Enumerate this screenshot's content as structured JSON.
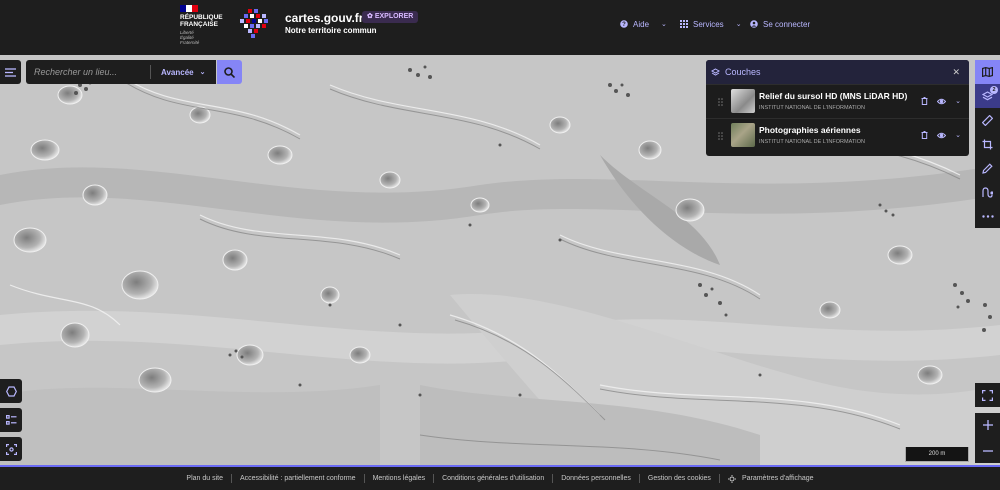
{
  "header": {
    "republic": "République Française",
    "motto_line1": "Liberté",
    "motto_line2": "Égalité",
    "motto_line3": "Fraternité",
    "site_title": "cartes.gouv.fr",
    "badge": "EXPLORER",
    "tagline": "Notre territoire commun",
    "nav": {
      "help": "Aide",
      "services": "Services",
      "login": "Se connecter"
    },
    "flag_colors": [
      "#000091",
      "#ffffff",
      "#e1000f"
    ]
  },
  "search": {
    "placeholder": "Rechercher un lieu...",
    "advanced": "Avancée"
  },
  "layers": {
    "title": "Couches",
    "count": "2",
    "items": [
      {
        "name": "Relief du sursol HD (MNS LiDAR HD)",
        "source": "Institut national de l'information"
      },
      {
        "name": "Photographies aériennes",
        "source": "Institut national de l'information"
      }
    ]
  },
  "scale": {
    "label": "200 m"
  },
  "footer": {
    "links": [
      "Plan du site",
      "Accessibilité : partiellement conforme",
      "Mentions légales",
      "Conditions générales d'utilisation",
      "Données personnelles",
      "Gestion des cookies",
      "Paramètres d'affichage"
    ]
  },
  "colors": {
    "accent": "#8585f6",
    "accent_text": "#b9b7ff",
    "dark_bg": "#1e1e1e",
    "badge_bg": "#3a2b4f"
  }
}
